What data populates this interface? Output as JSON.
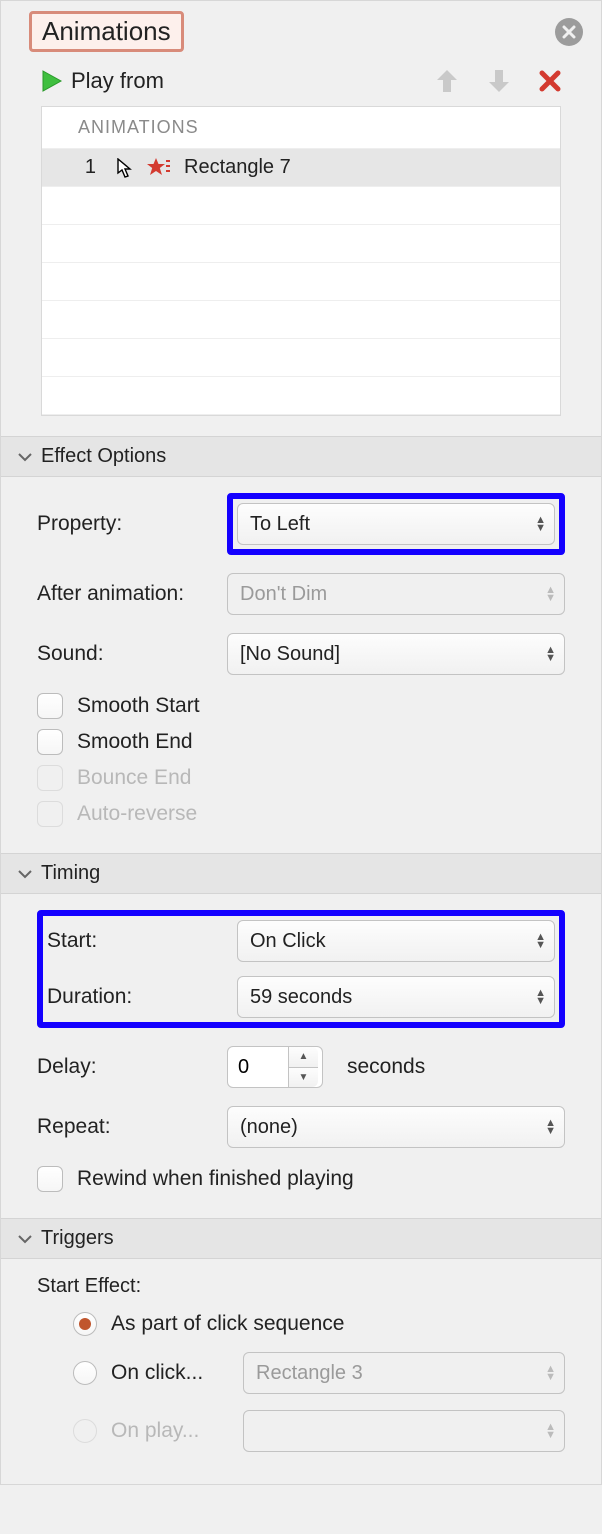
{
  "header": {
    "title": "Animations"
  },
  "play": {
    "label": "Play from"
  },
  "animations": {
    "list_header": "ANIMATIONS",
    "items": [
      {
        "order": "1",
        "label": "Rectangle 7"
      }
    ]
  },
  "effect_options": {
    "title": "Effect Options",
    "property": {
      "label": "Property:",
      "value": "To Left"
    },
    "after_animation": {
      "label": "After animation:",
      "value": "Don't Dim"
    },
    "sound": {
      "label": "Sound:",
      "value": "[No Sound]"
    },
    "checks": {
      "smooth_start": "Smooth Start",
      "smooth_end": "Smooth End",
      "bounce_end": "Bounce End",
      "auto_reverse": "Auto-reverse"
    }
  },
  "timing": {
    "title": "Timing",
    "start": {
      "label": "Start:",
      "value": "On Click"
    },
    "duration": {
      "label": "Duration:",
      "value": "59 seconds"
    },
    "delay": {
      "label": "Delay:",
      "value": "0",
      "unit": "seconds"
    },
    "repeat": {
      "label": "Repeat:",
      "value": "(none)"
    },
    "rewind": "Rewind when finished playing"
  },
  "triggers": {
    "title": "Triggers",
    "start_effect_label": "Start Effect:",
    "opts": {
      "click_sequence": "As part of click sequence",
      "on_click": {
        "label": "On click...",
        "value": "Rectangle 3"
      },
      "on_play": {
        "label": "On play..."
      }
    }
  }
}
